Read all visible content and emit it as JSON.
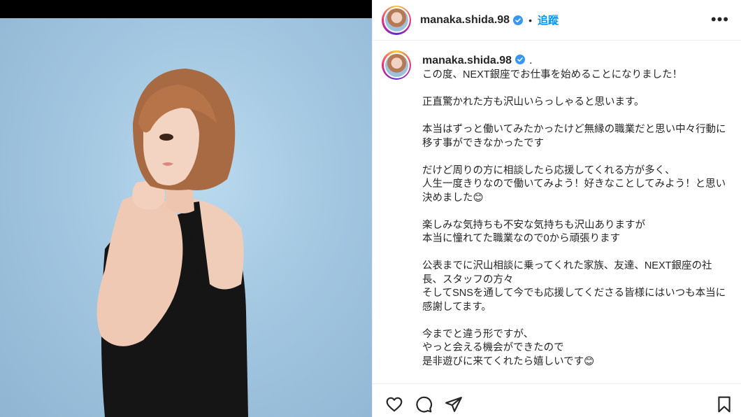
{
  "post": {
    "username": "manaka.shida.98",
    "separator": "•",
    "follow_label": "追蹤",
    "more_icon": "more-options-icon",
    "more_glyph": "•••",
    "caption_period": ".",
    "caption_lines": [
      "この度、NEXT銀座でお仕事を始めることになりました！",
      "",
      "正直驚かれた方も沢山いらっしゃると思います。",
      "",
      "本当はずっと働いてみたかったけど無縁の職業だと思い中々行動に移す事ができなかったです",
      "",
      "だけど周りの方に相談したら応援してくれる方が多く、",
      "人生一度きりなので働いてみよう！好きなことしてみよう！と思い決めました😊",
      "",
      "楽しみな気持ちも不安な気持ちも沢山ありますが",
      "本当に憧れてた職業なので0から頑張ります",
      "",
      "公表までに沢山相談に乗ってくれた家族、友達、NEXT銀座の社長、スタッフの方々",
      "そしてSNSを通して今でも応援してくださる皆様にはいつも本当に感謝してます。",
      "",
      "今までと違う形ですが、",
      "やっと会える機会ができたので",
      "是非遊びに来てくれたら嬉しいです😊"
    ]
  },
  "actions": [
    "heart-icon",
    "comment-icon",
    "share-icon",
    "bookmark-icon"
  ],
  "colors": {
    "accent": "#0095f6",
    "text": "#262626",
    "border": "#efefef",
    "photo_bg": "#a3c7e1"
  }
}
